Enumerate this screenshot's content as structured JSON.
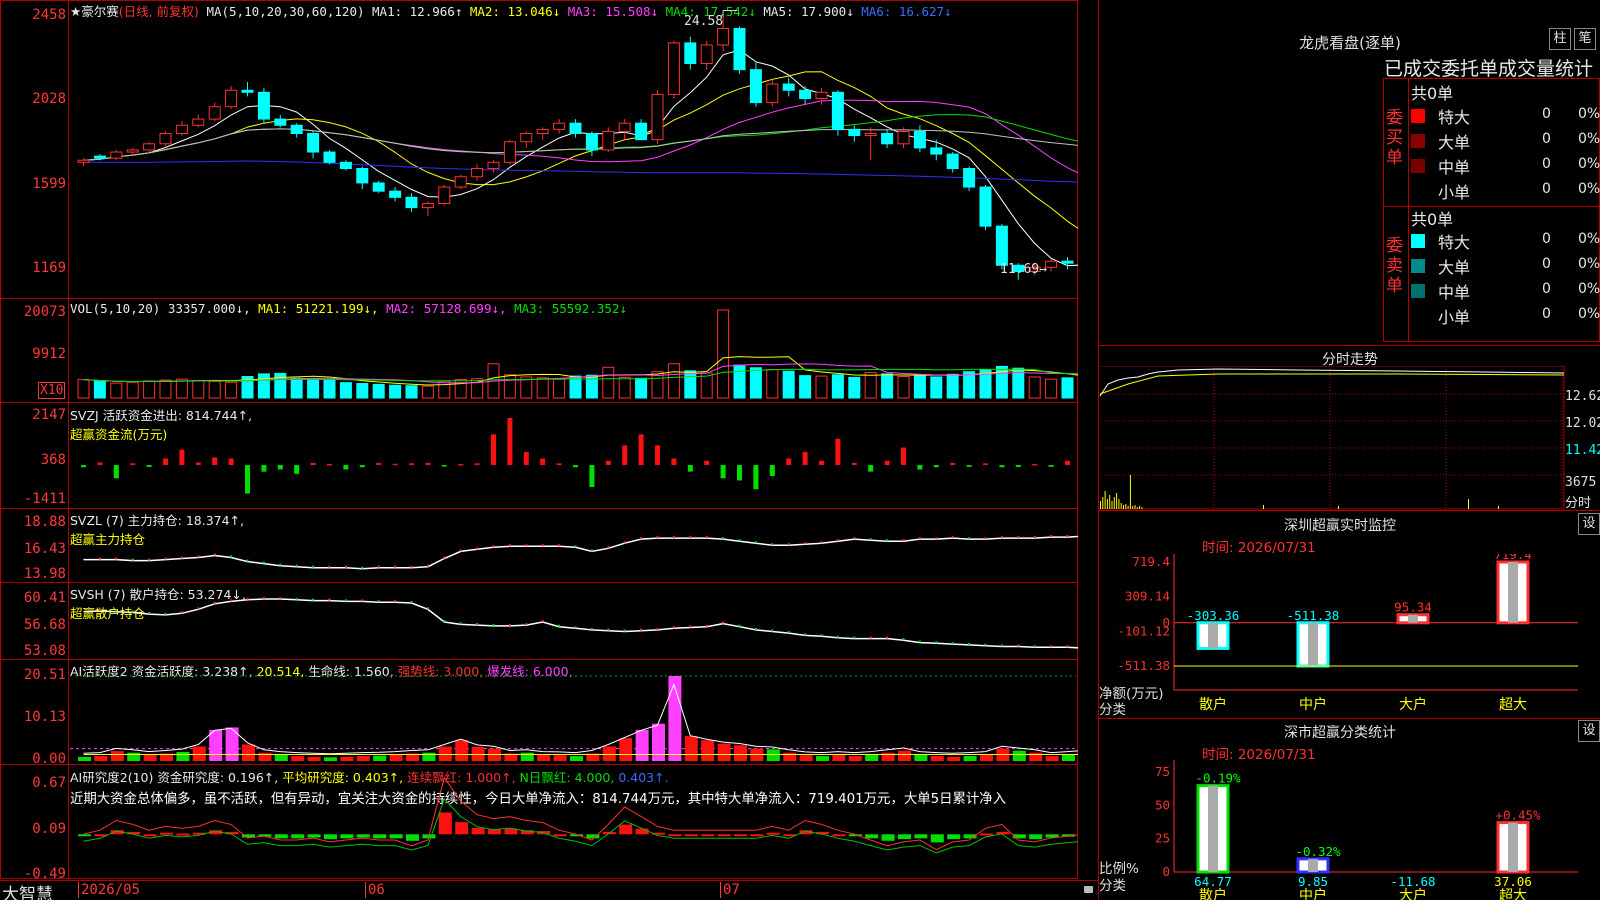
{
  "main": {
    "stock_name": "★豪尔赛",
    "mode": "(日线, 前复权)",
    "ma_spec": "MA(5,10,20,30,60,120)",
    "ma1": "MA1: 12.966↑",
    "ma2": "MA2: 13.046↓",
    "ma3": "MA3: 15.508↓",
    "ma4": "MA4: 17.542↓",
    "ma5": "MA5: 17.900↓",
    "ma6": "MA6: 16.627↓",
    "high_marker": "24.58",
    "low_marker": "11.69→",
    "y_labels": [
      "2458",
      "2028",
      "1599",
      "1169"
    ]
  },
  "vol": {
    "title": "VOL(5,10,20) 33357.000↓,",
    "ma1": "MA1: 51221.199↓,",
    "ma2": "MA2: 57128.699↓,",
    "ma3": "MA3: 55592.352↓",
    "y_labels": [
      "20073",
      "9912"
    ],
    "unit": "X10"
  },
  "svzj": {
    "title": "SVZJ  活跃资金进出: 814.744↑,",
    "sub": "超赢资金流(万元)",
    "y_labels": [
      "2147",
      "368",
      "-1411"
    ]
  },
  "svzl": {
    "title": "SVZL (7) 主力持仓: 18.374↑,",
    "sub": "超赢主力持仓",
    "y_labels": [
      "18.88",
      "16.43",
      "13.98"
    ]
  },
  "svsh": {
    "title": "SVSH (7) 散户持仓: 53.274↓,",
    "sub": "超赢散户持仓",
    "y_labels": [
      "60.41",
      "56.68",
      "53.08"
    ]
  },
  "ai1": {
    "title": "AI活跃度2 资金活跃度: 3.238↑,",
    "v2": "20.514,",
    "life": "生命线: 1.560,",
    "strong": "强势线: 3.000,",
    "burst": "爆发线: 6.000,",
    "y_labels": [
      "20.51",
      "10.13",
      "0.00"
    ]
  },
  "ai2": {
    "title": "AI研究度2(10) 资金研究度: 0.196↑,",
    "avg": "平均研究度: 0.403↑,",
    "cont": "连续飘红: 1.000↑,",
    "nday": "N日飘红: 4.000,",
    "nday2": "0.403↑.",
    "comment": "近期大资金总体偏多，虽不活跃，但有异动，宜关注大资金的持续性，今日大单净流入：814.744万元，其中特大单净流入：719.401万元，大单5日累计净入",
    "y_labels": [
      "0.67",
      "0.09",
      "-0.49"
    ]
  },
  "bottom": {
    "brand": "大智慧",
    "dates": [
      "2026/05",
      "06",
      "07"
    ]
  },
  "lhb": {
    "title": "龙虎看盘(逐单)",
    "btn1": "柱",
    "btn2": "笔",
    "tabs": "已成交委托单成交量统计",
    "buy_label": "委买单",
    "sell_label": "委卖单",
    "buy_total": "共0单",
    "sell_total": "共0单",
    "rows": [
      "特大",
      "大单",
      "中单",
      "小单"
    ],
    "zero": "0",
    "pct": "0%",
    "colors_buy": [
      "#ff0000",
      "#8b0000",
      "#7a0000",
      ""
    ],
    "colors_sell": [
      "#00ffff",
      "#008b8b",
      "#007070",
      ""
    ]
  },
  "fst": {
    "title": "分时走势",
    "y_labels": [
      "12.62",
      "12.02",
      "11.42"
    ],
    "vol_label": "3675",
    "vol_unit": "分时"
  },
  "sz_monitor": {
    "title": "深圳超赢实时监控",
    "btn": "设",
    "time": "时间: 2026/07/31",
    "y_labels": [
      "719.4",
      "309.14",
      "-101.12",
      "-511.38"
    ],
    "y_zero": "0",
    "y_axis_title": "净额(万元)",
    "x_axis_title": "分类",
    "categories": [
      "散户",
      "中户",
      "大户",
      "超大"
    ],
    "value_labels": [
      "-303.36",
      "-511.38",
      "95.34",
      "719.4"
    ]
  },
  "sz_class": {
    "title": "深市超赢分类统计",
    "btn": "设",
    "time": "时间: 2026/07/31",
    "y_labels": [
      "75",
      "50",
      "25",
      "0"
    ],
    "y_axis_title": "比例%",
    "x_axis_title": "分类",
    "categories": [
      "散户",
      "中户",
      "大户",
      "超大"
    ],
    "top_labels": [
      "-0.19%",
      "-0.32%",
      "",
      "+0.45%"
    ],
    "bottom_labels": [
      "64.77",
      "9.85",
      "-11.68",
      "37.06"
    ]
  },
  "chart_data": [
    {
      "type": "candlestick",
      "title": "★豪尔赛(日线, 前复权)",
      "ylim": [
        11.3,
        24.8
      ],
      "x_labels": [
        "2026/05",
        "06",
        "07"
      ],
      "ohlc": [
        [
          17.5,
          17.7,
          17.3,
          17.6
        ],
        [
          17.8,
          17.9,
          17.6,
          17.7
        ],
        [
          17.7,
          18.1,
          17.6,
          18.0
        ],
        [
          18.0,
          18.2,
          17.9,
          18.1
        ],
        [
          18.1,
          18.5,
          18.0,
          18.4
        ],
        [
          18.4,
          19.0,
          18.3,
          18.9
        ],
        [
          18.9,
          19.5,
          18.8,
          19.3
        ],
        [
          19.3,
          19.8,
          19.2,
          19.6
        ],
        [
          19.6,
          20.4,
          19.5,
          20.2
        ],
        [
          20.2,
          21.2,
          20.1,
          21.0
        ],
        [
          21.0,
          21.4,
          20.7,
          20.9
        ],
        [
          20.9,
          21.1,
          19.4,
          19.6
        ],
        [
          19.6,
          19.8,
          19.2,
          19.3
        ],
        [
          19.3,
          19.4,
          18.7,
          18.9
        ],
        [
          18.9,
          19.0,
          17.7,
          18.0
        ],
        [
          18.0,
          18.1,
          17.4,
          17.5
        ],
        [
          17.5,
          17.6,
          17.1,
          17.2
        ],
        [
          17.2,
          17.3,
          16.2,
          16.5
        ],
        [
          16.5,
          16.6,
          16.0,
          16.1
        ],
        [
          16.1,
          16.3,
          15.6,
          15.8
        ],
        [
          15.8,
          16.0,
          15.1,
          15.3
        ],
        [
          15.3,
          15.6,
          14.9,
          15.5
        ],
        [
          15.5,
          16.4,
          15.4,
          16.3
        ],
        [
          16.3,
          16.9,
          16.2,
          16.8
        ],
        [
          16.8,
          17.4,
          16.6,
          17.2
        ],
        [
          17.2,
          17.6,
          17.0,
          17.5
        ],
        [
          17.5,
          18.6,
          17.4,
          18.5
        ],
        [
          18.5,
          19.0,
          18.2,
          18.9
        ],
        [
          18.9,
          19.2,
          18.6,
          19.1
        ],
        [
          19.1,
          19.6,
          18.9,
          19.4
        ],
        [
          19.4,
          19.6,
          18.7,
          18.9
        ],
        [
          18.9,
          19.0,
          17.8,
          18.1
        ],
        [
          18.1,
          19.2,
          18.0,
          19.0
        ],
        [
          19.0,
          19.6,
          18.6,
          19.4
        ],
        [
          19.4,
          19.6,
          18.6,
          18.6
        ],
        [
          18.6,
          21.0,
          18.4,
          20.8
        ],
        [
          20.8,
          23.4,
          20.6,
          23.3
        ],
        [
          23.3,
          23.6,
          22.0,
          22.3
        ],
        [
          22.3,
          23.4,
          22.0,
          23.2
        ],
        [
          23.2,
          24.58,
          22.9,
          24.0
        ],
        [
          24.0,
          24.1,
          21.8,
          22.0
        ],
        [
          22.0,
          22.4,
          20.2,
          20.4
        ],
        [
          20.4,
          21.5,
          20.2,
          21.3
        ],
        [
          21.3,
          21.6,
          20.7,
          21.0
        ],
        [
          21.0,
          21.2,
          20.3,
          20.6
        ],
        [
          20.6,
          21.1,
          20.3,
          20.9
        ],
        [
          20.9,
          21.0,
          18.8,
          19.1
        ],
        [
          19.1,
          19.3,
          18.5,
          18.8
        ],
        [
          18.8,
          19.2,
          17.6,
          18.9
        ],
        [
          18.9,
          19.1,
          18.2,
          18.4
        ],
        [
          18.4,
          19.2,
          18.2,
          19.0
        ],
        [
          19.0,
          19.3,
          18.0,
          18.2
        ],
        [
          18.2,
          18.6,
          17.6,
          17.9
        ],
        [
          17.9,
          18.0,
          17.0,
          17.2
        ],
        [
          17.2,
          17.3,
          16.1,
          16.3
        ],
        [
          16.3,
          16.4,
          14.2,
          14.4
        ],
        [
          14.4,
          14.5,
          12.3,
          12.5
        ],
        [
          12.5,
          12.6,
          11.8,
          12.2
        ],
        [
          12.2,
          12.6,
          12.0,
          12.4
        ],
        [
          12.4,
          12.8,
          12.2,
          12.7
        ],
        [
          12.7,
          12.9,
          12.3,
          12.6
        ],
        [
          12.6,
          12.8,
          12.3,
          12.7
        ],
        [
          12.7,
          13.2,
          12.3,
          12.5
        ],
        [
          12.5,
          12.6,
          11.8,
          11.95
        ],
        [
          11.95,
          12.6,
          11.69,
          12.3
        ],
        [
          12.3,
          12.7,
          12.2,
          12.6
        ]
      ]
    },
    {
      "type": "bar",
      "title": "VOL(5,10,20)",
      "ylim": [
        0,
        20073
      ],
      "series": [
        {
          "name": "VOL",
          "values": [
            4200,
            3800,
            3400,
            3600,
            3900,
            4100,
            4300,
            4000,
            3800,
            3600,
            4900,
            5500,
            5600,
            4500,
            4400,
            4000,
            3500,
            3300,
            3100,
            2900,
            2800,
            2700,
            3800,
            4200,
            4400,
            7800,
            5300,
            4800,
            4600,
            4300,
            5000,
            5200,
            7000,
            4700,
            4500,
            6000,
            7800,
            6200,
            5700,
            20073,
            7500,
            6900,
            6500,
            6100,
            5100,
            5000,
            5300,
            4700,
            5800,
            5500,
            4900,
            5200,
            4800,
            5400,
            6000,
            6500,
            7200,
            6800,
            4800,
            4300,
            4600,
            4700,
            5000,
            4500,
            4200,
            3336
          ]
        }
      ]
    },
    {
      "type": "bar",
      "title": "SVZJ 活跃资金进出",
      "ylim": [
        -1411,
        2147
      ],
      "series": [
        {
          "name": "活跃资金进出",
          "values": [
            -100,
            120,
            -600,
            80,
            -90,
            300,
            700,
            120,
            350,
            300,
            -1300,
            -300,
            -200,
            -400,
            100,
            50,
            -200,
            -100,
            100,
            60,
            80,
            100,
            -60,
            50,
            80,
            1400,
            2147,
            600,
            300,
            80,
            -100,
            -1000,
            200,
            900,
            1400,
            900,
            300,
            -300,
            200,
            -600,
            -700,
            -1100,
            -500,
            300,
            600,
            200,
            1200,
            100,
            -300,
            200,
            800,
            -200,
            -100,
            100,
            -80,
            80,
            -100,
            -90,
            50,
            -80,
            200,
            -100,
            100,
            200,
            -100,
            814.744
          ]
        }
      ]
    },
    {
      "type": "line",
      "title": "SVZL (7) 主力持仓",
      "ylim": [
        13.98,
        18.88
      ],
      "series": [
        {
          "name": "主力持仓",
          "values": [
            15.2,
            15.2,
            15.2,
            15.1,
            15.1,
            15.2,
            15.3,
            15.4,
            15.6,
            15.4,
            15.0,
            14.8,
            14.6,
            14.5,
            14.4,
            14.4,
            14.4,
            14.3,
            14.4,
            14.4,
            14.4,
            14.5,
            15.3,
            16.0,
            16.2,
            16.4,
            16.5,
            16.5,
            16.5,
            16.5,
            16.4,
            16.0,
            16.3,
            16.8,
            17.2,
            17.3,
            17.3,
            17.3,
            17.3,
            17.2,
            17.0,
            16.8,
            16.6,
            16.6,
            16.7,
            16.8,
            17.0,
            17.2,
            17.1,
            17.0,
            17.0,
            17.2,
            17.2,
            17.3,
            17.2,
            17.2,
            17.3,
            17.3,
            17.3,
            17.4,
            17.4,
            17.5,
            17.6,
            17.7,
            17.9,
            18.374
          ]
        }
      ]
    },
    {
      "type": "line",
      "title": "SVSH (7) 散户持仓",
      "ylim": [
        53.08,
        60.41
      ],
      "series": [
        {
          "name": "散户持仓",
          "values": [
            58.3,
            58.4,
            58.3,
            58.2,
            58.0,
            57.9,
            58.1,
            58.6,
            59.3,
            59.6,
            59.8,
            59.9,
            59.9,
            59.8,
            59.7,
            59.7,
            59.6,
            59.6,
            59.5,
            59.5,
            59.4,
            58.6,
            57.0,
            56.7,
            56.6,
            56.5,
            56.5,
            56.6,
            57.0,
            56.4,
            56.2,
            56.0,
            55.9,
            55.8,
            55.9,
            56.0,
            56.2,
            56.3,
            56.4,
            56.8,
            56.4,
            56.0,
            55.8,
            55.6,
            55.3,
            55.2,
            55.0,
            54.9,
            54.9,
            54.9,
            54.7,
            54.4,
            54.3,
            54.2,
            54.1,
            54.0,
            53.9,
            53.9,
            53.8,
            53.8,
            53.8,
            53.7,
            53.6,
            53.5,
            53.4,
            53.274
          ]
        }
      ]
    },
    {
      "type": "bar",
      "title": "AI活跃度2 资金活跃度",
      "ylim": [
        0,
        20.51
      ],
      "series": [
        {
          "name": "资金活跃度",
          "values": [
            1.0,
            1.2,
            2.4,
            2.0,
            1.5,
            1.8,
            2.2,
            3.5,
            7.5,
            8.1,
            4.0,
            2.0,
            1.5,
            1.2,
            1.0,
            0.9,
            1.0,
            1.2,
            1.3,
            1.5,
            1.8,
            2.0,
            3.5,
            5.0,
            3.4,
            3.0,
            1.8,
            2.0,
            1.5,
            1.4,
            1.2,
            1.8,
            3.5,
            5.5,
            7.5,
            9.0,
            20.514,
            6.0,
            5.0,
            4.2,
            3.8,
            3.0,
            2.8,
            2.0,
            1.4,
            1.2,
            1.5,
            1.2,
            1.5,
            2.0,
            2.5,
            1.5,
            1.2,
            1.0,
            1.2,
            1.5,
            3.0,
            2.5,
            2.0,
            1.2,
            1.5,
            1.8,
            4.5,
            2.0,
            1.5,
            3.238
          ]
        }
      ]
    },
    {
      "type": "bar",
      "title": "AI研究度2(10) 资金研究度",
      "ylim": [
        -0.49,
        0.67
      ],
      "series": [
        {
          "name": "资金研究度",
          "values": [
            -0.02,
            0.0,
            0.05,
            0.03,
            0.0,
            0.02,
            0.01,
            0.02,
            0.05,
            0.03,
            -0.04,
            -0.03,
            -0.05,
            -0.05,
            -0.04,
            -0.06,
            -0.05,
            -0.04,
            -0.05,
            -0.05,
            -0.08,
            -0.05,
            0.27,
            0.15,
            0.08,
            0.06,
            0.07,
            0.05,
            0.04,
            0.0,
            -0.02,
            -0.05,
            0.03,
            0.12,
            0.07,
            0.02,
            0.0,
            0.0,
            0.0,
            0.0,
            0.0,
            0.0,
            0.02,
            0.0,
            0.05,
            0.03,
            0.0,
            -0.02,
            -0.05,
            -0.08,
            -0.06,
            -0.05,
            -0.1,
            -0.06,
            -0.05,
            0.01,
            0.03,
            -0.05,
            -0.06,
            -0.04,
            -0.03,
            -0.02,
            0.05,
            -0.05,
            -0.05,
            0.196
          ]
        }
      ]
    },
    {
      "type": "bar",
      "title": "深圳超赢实时监控",
      "categories": [
        "散户",
        "中户",
        "大户",
        "超大"
      ],
      "values": [
        -303.36,
        -511.38,
        95.34,
        719.4
      ],
      "ylabel": "净额(万元)",
      "xlabel": "分类",
      "ylim": [
        -511.38,
        719.4
      ]
    },
    {
      "type": "bar",
      "title": "深市超赢分类统计",
      "categories": [
        "散户",
        "中户",
        "大户",
        "超大"
      ],
      "values": [
        64.77,
        9.85,
        -11.68,
        37.06
      ],
      "ylabel": "比例%",
      "xlabel": "分类",
      "ylim": [
        0,
        75
      ]
    }
  ]
}
